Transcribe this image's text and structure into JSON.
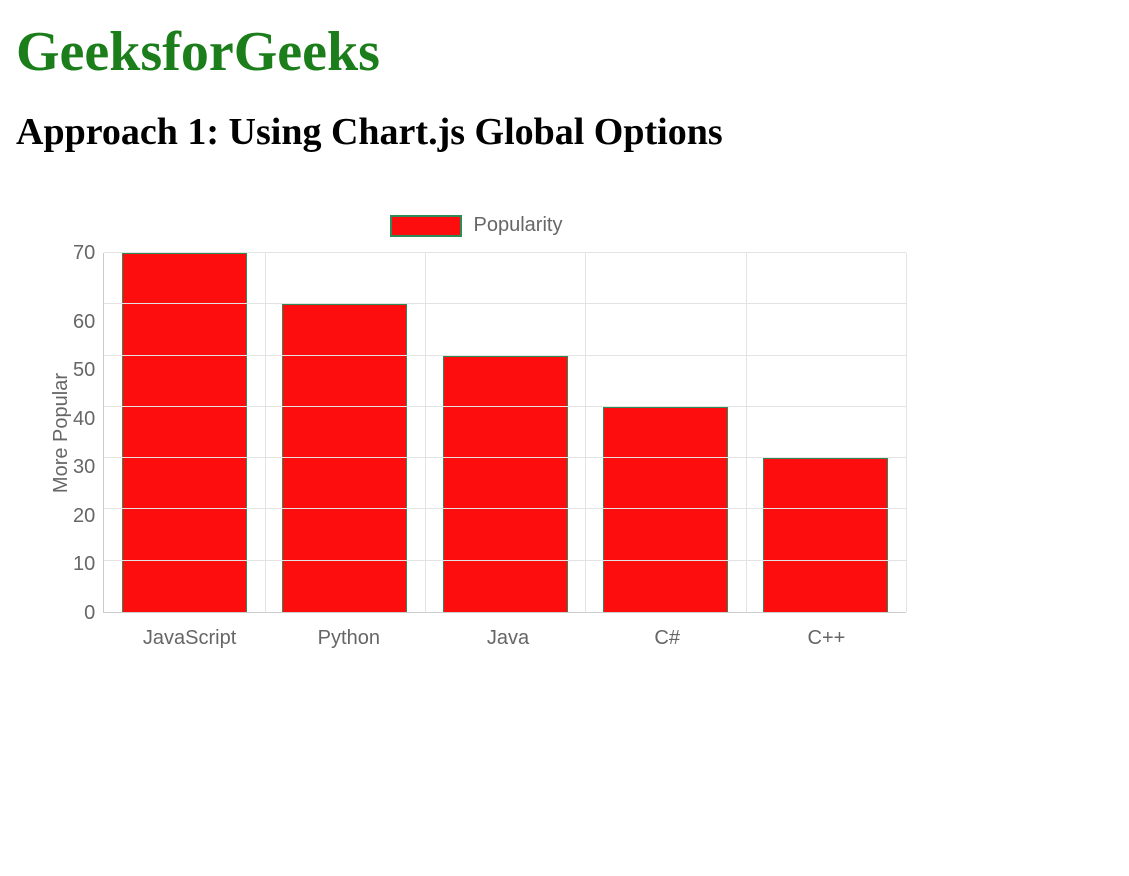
{
  "page": {
    "title": "GeeksforGeeks",
    "subtitle": "Approach 1: Using Chart.js Global Options"
  },
  "chart_data": {
    "type": "bar",
    "categories": [
      "JavaScript",
      "Python",
      "Java",
      "C#",
      "C++"
    ],
    "values": [
      70,
      60,
      50,
      40,
      30
    ],
    "series": [
      {
        "name": "Popularity",
        "values": [
          70,
          60,
          50,
          40,
          30
        ]
      }
    ],
    "title": "",
    "xlabel": "",
    "ylabel": "More Popular",
    "ylim": [
      0,
      70
    ],
    "yticks": [
      0,
      10,
      20,
      30,
      40,
      50,
      60,
      70
    ],
    "legend": {
      "label": "Popularity",
      "position": "top"
    },
    "colors": {
      "fill": "#fd0d0d",
      "border": "#2e8b57"
    },
    "grid": true
  }
}
